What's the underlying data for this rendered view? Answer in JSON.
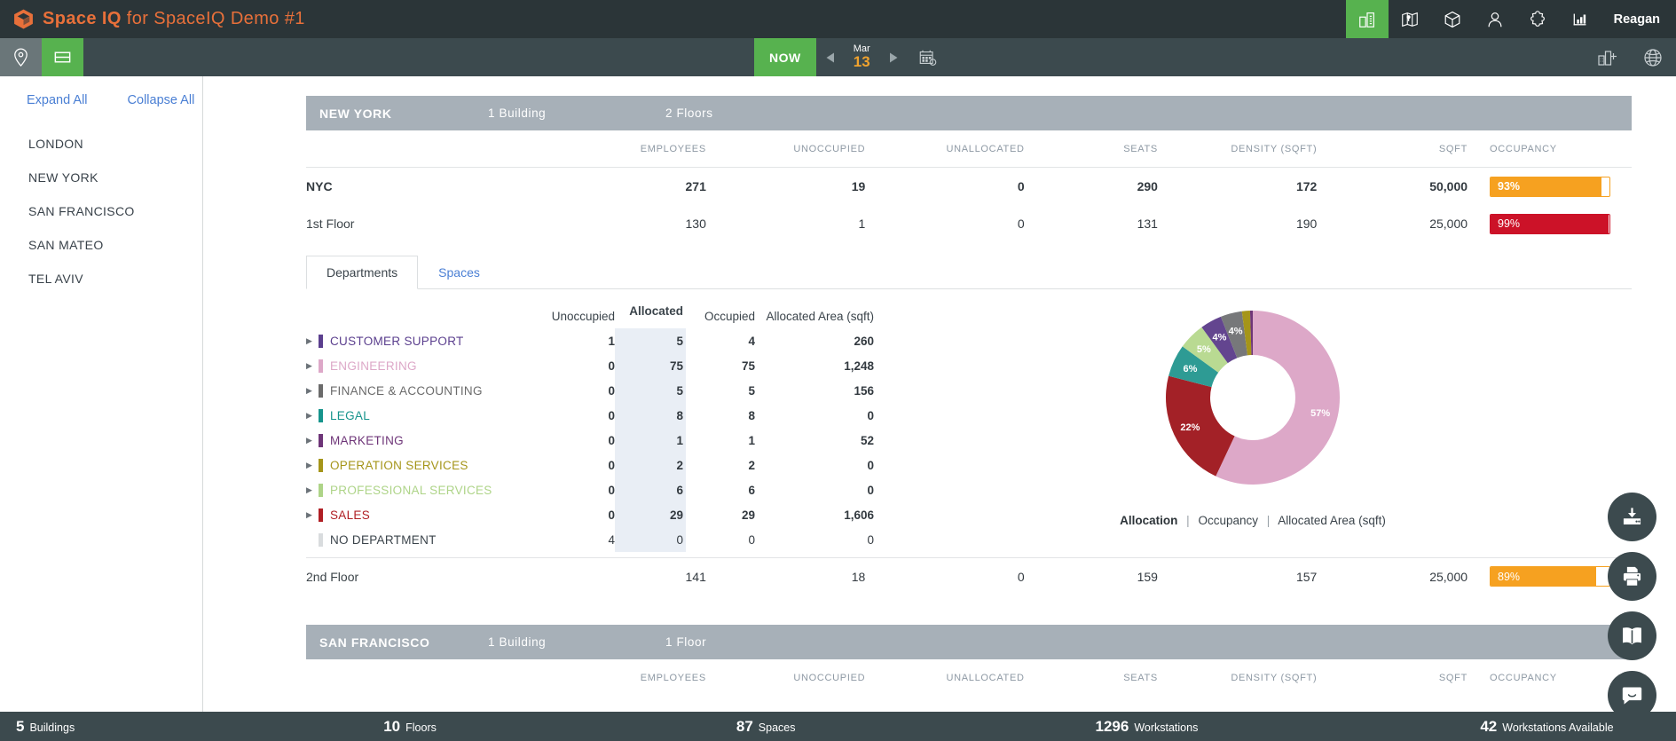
{
  "app": {
    "brand_bold": "Space IQ",
    "brand_suffix": " for SpaceIQ Demo #1",
    "username": "Reagan"
  },
  "topnav": {
    "icons": [
      {
        "name": "buildings-icon",
        "active": true
      },
      {
        "name": "map-icon",
        "active": false
      },
      {
        "name": "box-icon",
        "active": false
      },
      {
        "name": "person-icon",
        "active": false
      },
      {
        "name": "puzzle-icon",
        "active": false
      },
      {
        "name": "chart-icon",
        "active": false
      }
    ]
  },
  "toolbar": {
    "pin_tool": "location-pin-icon",
    "grid_tool": "stack-view-icon",
    "now_label": "NOW",
    "date_month": "Mar",
    "date_day": "13",
    "calendar_icon": "calendar-icon",
    "add_building_icon": "add-building-icon",
    "globe_icon": "globe-icon"
  },
  "sidebar": {
    "expand_all": "Expand All",
    "collapse_all": "Collapse All",
    "items": [
      {
        "label": "LONDON"
      },
      {
        "label": "NEW YORK"
      },
      {
        "label": "SAN FRANCISCO"
      },
      {
        "label": "SAN MATEO"
      },
      {
        "label": "TEL AVIV"
      }
    ]
  },
  "columns": {
    "employees": "EMPLOYEES",
    "unoccupied": "UNOCCUPIED",
    "unallocated": "UNALLOCATED",
    "seats": "SEATS",
    "density": "DENSITY (SQFT)",
    "sqft": "SQFT",
    "occupancy": "OCCUPANCY"
  },
  "sections": [
    {
      "name": "NEW YORK",
      "buildings": "1 Building",
      "floors": "2 Floors",
      "rows": [
        {
          "name": "NYC",
          "employees": "271",
          "unoccupied": "19",
          "unallocated": "0",
          "seats": "290",
          "density": "172",
          "sqft": "50,000",
          "occupancy": "93%",
          "occupancy_pct": 93,
          "occupancy_color": "#f6a120"
        },
        {
          "name": "1st Floor",
          "employees": "130",
          "unoccupied": "1",
          "unallocated": "0",
          "seats": "131",
          "density": "190",
          "sqft": "25,000",
          "occupancy": "99%",
          "occupancy_pct": 99,
          "occupancy_color": "#cc1228"
        }
      ],
      "floor2": {
        "name": "2nd Floor",
        "employees": "141",
        "unoccupied": "18",
        "unallocated": "0",
        "seats": "159",
        "density": "157",
        "sqft": "25,000",
        "occupancy": "89%",
        "occupancy_pct": 89,
        "occupancy_color": "#f6a120"
      }
    },
    {
      "name": "SAN FRANCISCO",
      "buildings": "1 Building",
      "floors": "1 Floor"
    }
  ],
  "tabs": [
    {
      "label": "Departments",
      "active": true
    },
    {
      "label": "Spaces",
      "active": false
    }
  ],
  "dept_table": {
    "headers": {
      "unoccupied": "Unoccupied",
      "allocated": "Allocated",
      "occupied": "Occupied",
      "area": "Allocated Area (sqft)"
    },
    "rows": [
      {
        "label": "CUSTOMER SUPPORT",
        "color": "#5b3f8e",
        "unoccupied": "1",
        "allocated": "5",
        "occupied": "4",
        "area": "260",
        "expandable": true
      },
      {
        "label": "ENGINEERING",
        "color": "#dda8c8",
        "unoccupied": "0",
        "allocated": "75",
        "occupied": "75",
        "area": "1,248",
        "expandable": true
      },
      {
        "label": "FINANCE & ACCOUNTING",
        "color": "#6b6b6b",
        "unoccupied": "0",
        "allocated": "5",
        "occupied": "5",
        "area": "156",
        "expandable": true
      },
      {
        "label": "LEGAL",
        "color": "#16948c",
        "unoccupied": "0",
        "allocated": "8",
        "occupied": "8",
        "area": "0",
        "expandable": true
      },
      {
        "label": "MARKETING",
        "color": "#6e3578",
        "unoccupied": "0",
        "allocated": "1",
        "occupied": "1",
        "area": "52",
        "expandable": true
      },
      {
        "label": "OPERATION SERVICES",
        "color": "#a59519",
        "unoccupied": "0",
        "allocated": "2",
        "occupied": "2",
        "area": "0",
        "expandable": true
      },
      {
        "label": "PROFESSIONAL SERVICES",
        "color": "#aed488",
        "unoccupied": "0",
        "allocated": "6",
        "occupied": "6",
        "area": "0",
        "expandable": true
      },
      {
        "label": "SALES",
        "color": "#b01f24",
        "unoccupied": "0",
        "allocated": "29",
        "occupied": "29",
        "area": "1,606",
        "expandable": true
      },
      {
        "label": "NO DEPARTMENT",
        "color": "#d9dcde",
        "unoccupied": "4",
        "allocated": "0",
        "occupied": "0",
        "area": "0",
        "expandable": false
      }
    ]
  },
  "chart_data": {
    "type": "pie",
    "title": "",
    "legend_position": "bottom",
    "labels": [
      "Engineering",
      "Sales",
      "Legal",
      "Professional Services",
      "Customer Support",
      "Finance & Accounting",
      "Operation Services",
      "Marketing"
    ],
    "values": [
      57,
      22,
      6,
      5,
      4,
      4,
      1.5,
      0.5
    ],
    "display_labels": [
      "57%",
      "22%",
      "6%",
      "5%",
      "4%",
      "4%",
      "",
      ""
    ],
    "colors": [
      "#dda8c8",
      "#a32127",
      "#2e9b94",
      "#b9da92",
      "#63458f",
      "#77787a",
      "#a59519",
      "#6e3578"
    ],
    "legend": [
      {
        "label": "Allocation",
        "active": true
      },
      {
        "label": "Occupancy",
        "active": false
      },
      {
        "label": "Allocated Area (sqft)",
        "active": false
      }
    ]
  },
  "statusbar": [
    {
      "num": "5",
      "label": "Buildings"
    },
    {
      "num": "10",
      "label": "Floors"
    },
    {
      "num": "87",
      "label": "Spaces"
    },
    {
      "num": "1296",
      "label": "Workstations"
    },
    {
      "num": "42",
      "label": "Workstations Available"
    }
  ],
  "fabs": [
    {
      "name": "download-icon"
    },
    {
      "name": "print-icon"
    },
    {
      "name": "book-icon"
    },
    {
      "name": "chat-icon"
    }
  ]
}
